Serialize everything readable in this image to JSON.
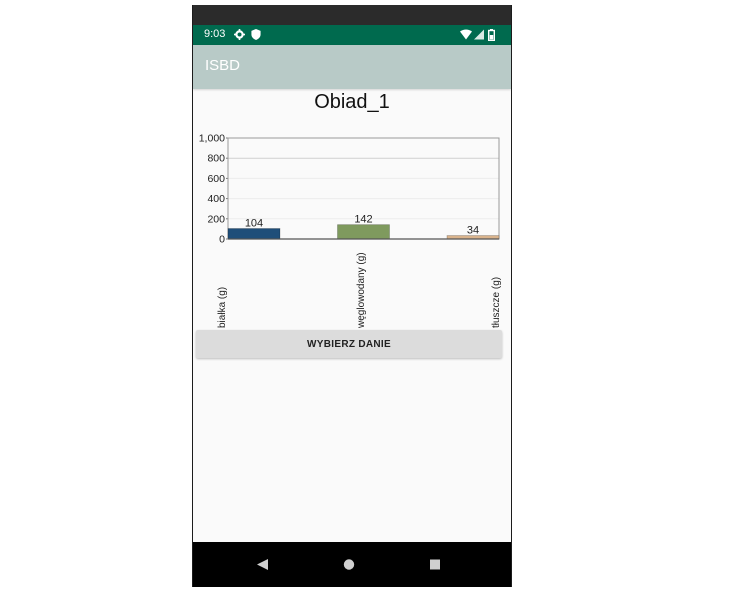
{
  "status_bar": {
    "time": "9:03",
    "icons": [
      "gear-icon",
      "shield-icon",
      "wifi-icon",
      "signal-icon",
      "battery-icon"
    ]
  },
  "app_bar": {
    "title": "ISBD"
  },
  "colors": {
    "status_bar": "#006a4e",
    "app_bar": "#b8cac7",
    "bar_protein": "#1f4e79",
    "bar_carbs": "#7f9a5e",
    "bar_fat": "#d9b38c"
  },
  "chart_data": {
    "type": "bar",
    "title": "Obiad_1",
    "categories": [
      "białka (g)",
      "węglowodany (g)",
      "tłuszcze (g)"
    ],
    "values": [
      104,
      142,
      34
    ],
    "data_labels": [
      "104",
      "142",
      "34"
    ],
    "ylim": [
      0,
      1000
    ],
    "yticks": [
      "0",
      "200",
      "400",
      "600",
      "800",
      "1,000"
    ],
    "grid": true,
    "legend": "none"
  },
  "button": {
    "label": "WYBIERZ DANIE"
  },
  "nav_bar": {
    "buttons": [
      "back-icon",
      "home-icon",
      "recents-icon"
    ]
  }
}
